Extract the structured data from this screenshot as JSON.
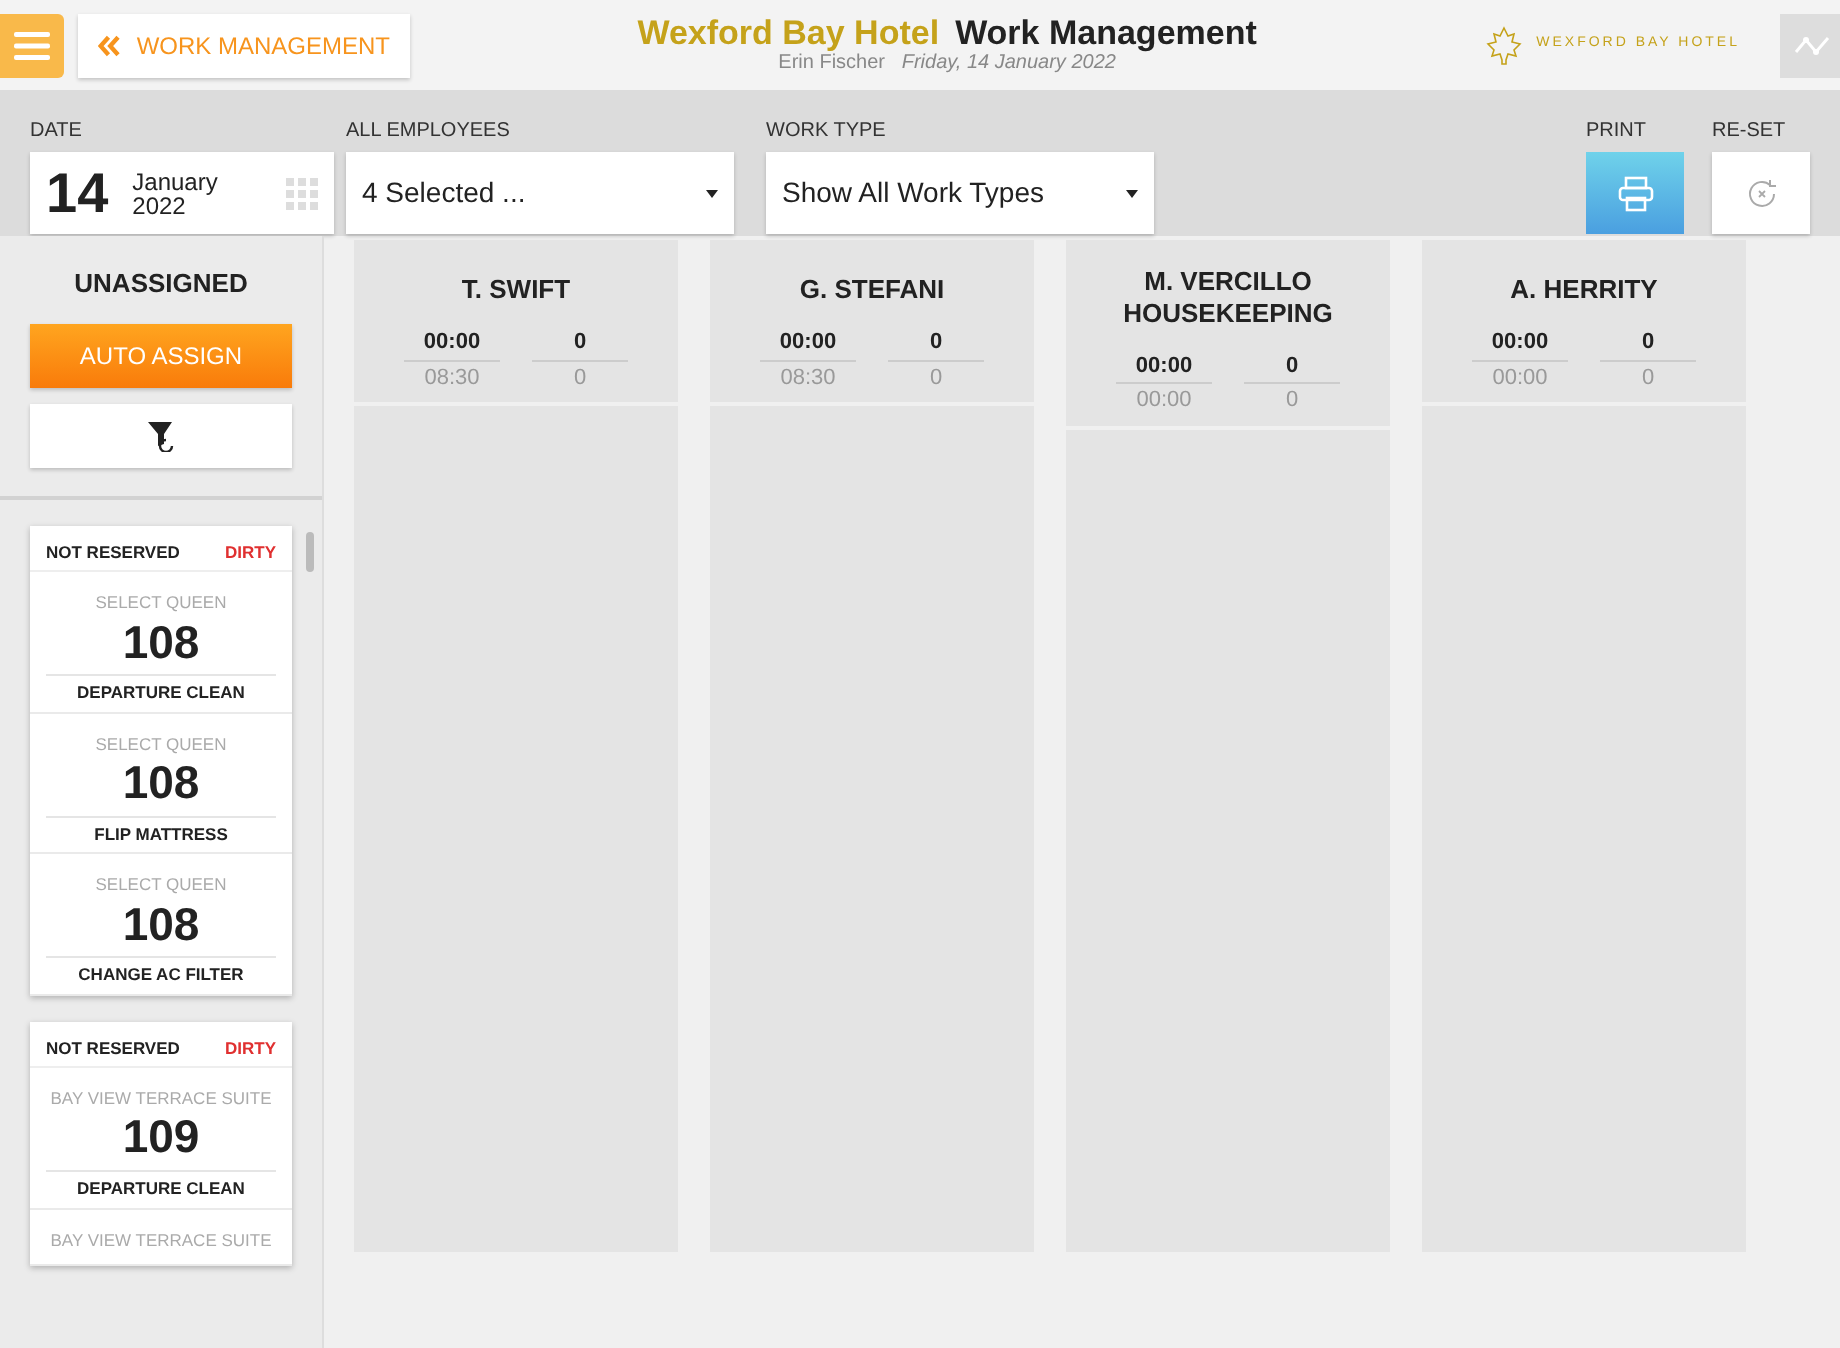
{
  "header": {
    "back_label": "WORK MANAGEMENT",
    "hotel": "Wexford Bay Hotel",
    "title": "Work Management",
    "user": "Erin Fischer",
    "date": "Friday, 14 January 2022",
    "logo_text": "WEXFORD BAY HOTEL"
  },
  "filters": {
    "date": {
      "label": "DATE",
      "day": "14",
      "month": "January",
      "year": "2022"
    },
    "employees": {
      "label": "ALL EMPLOYEES",
      "value": "4 Selected ..."
    },
    "work_type": {
      "label": "WORK TYPE",
      "value": "Show All Work Types"
    },
    "print": {
      "label": "PRINT"
    },
    "reset": {
      "label": "RE-SET"
    }
  },
  "unassigned": {
    "title": "UNASSIGNED",
    "auto_assign": "AUTO ASSIGN",
    "cards": [
      {
        "reservation": "NOT RESERVED",
        "status": "DIRTY",
        "color": "#e03030",
        "tasks": [
          {
            "room_type": "SELECT QUEEN",
            "room": "108",
            "task": "DEPARTURE CLEAN"
          },
          {
            "room_type": "SELECT QUEEN",
            "room": "108",
            "task": "FLIP MATTRESS"
          },
          {
            "room_type": "SELECT QUEEN",
            "room": "108",
            "task": "CHANGE AC FILTER"
          }
        ]
      },
      {
        "reservation": "NOT RESERVED",
        "status": "DIRTY",
        "color": "#e03030",
        "tasks": [
          {
            "room_type": "BAY VIEW TERRACE SUITE",
            "room": "109",
            "task": "DEPARTURE CLEAN"
          },
          {
            "room_type": "BAY VIEW TERRACE SUITE"
          }
        ]
      }
    ]
  },
  "employees": [
    {
      "name": "T. SWIFT",
      "time": "00:00",
      "count": "0",
      "planned_time": "08:30",
      "planned_count": "0"
    },
    {
      "name": "G. STEFANI",
      "time": "00:00",
      "count": "0",
      "planned_time": "08:30",
      "planned_count": "0"
    },
    {
      "name": "M. VERCILLO HOUSEKEEPING",
      "time": "00:00",
      "count": "0",
      "planned_time": "00:00",
      "planned_count": "0"
    },
    {
      "name": "A. HERRITY",
      "time": "00:00",
      "count": "0",
      "planned_time": "00:00",
      "planned_count": "0"
    }
  ]
}
